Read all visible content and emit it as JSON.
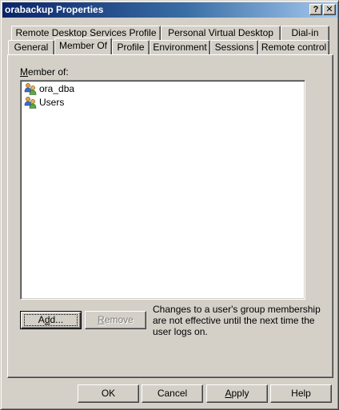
{
  "window": {
    "title": "orabackup Properties",
    "help_glyph": "?",
    "close_glyph": "✕"
  },
  "tabs_row1": [
    {
      "label": "Remote Desktop Services Profile"
    },
    {
      "label": "Personal Virtual Desktop"
    },
    {
      "label": "Dial-in"
    }
  ],
  "tabs_row2": [
    {
      "label": "General",
      "active": false
    },
    {
      "label": "Member Of",
      "active": true
    },
    {
      "label": "Profile",
      "active": false
    },
    {
      "label": "Environment",
      "active": false
    },
    {
      "label": "Sessions",
      "active": false
    },
    {
      "label": "Remote control",
      "active": false
    }
  ],
  "member_of": {
    "label_mnemonic": "M",
    "label_rest": "ember of:",
    "items": [
      {
        "name": "ora_dba",
        "icon": "group-icon"
      },
      {
        "name": "Users",
        "icon": "group-icon"
      }
    ]
  },
  "actions": {
    "add_mnemonic": "d",
    "add_prefix": "A",
    "add_suffix": "d...",
    "remove_mnemonic": "R",
    "remove_rest": "emove",
    "remove_enabled": false
  },
  "note": "Changes to a user's group membership are not effective until the next time the user logs on.",
  "footer": {
    "ok": "OK",
    "cancel": "Cancel",
    "apply_mnemonic": "A",
    "apply_rest": "pply",
    "help": "Help"
  },
  "colors": {
    "face": "#d4d0c8",
    "title_start": "#0a246a",
    "title_end": "#a6caf0"
  }
}
